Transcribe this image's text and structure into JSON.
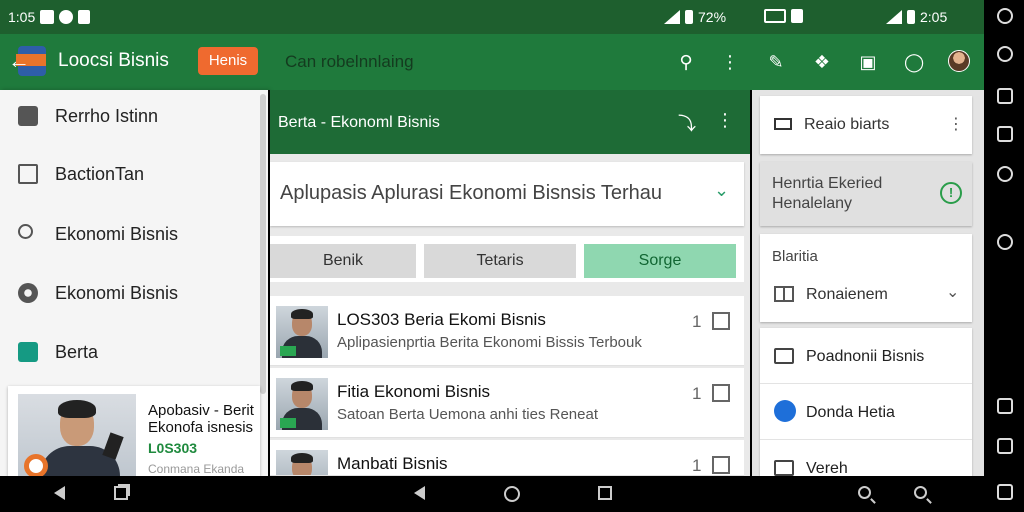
{
  "status_bar": {
    "time_left": "1:05",
    "battery_mid": "72%",
    "time_right": "2:05"
  },
  "app_bar": {
    "title": "Loocsi Bisnis",
    "chip": "Henis",
    "subtitle": "Can robelnnlaing"
  },
  "drawer": {
    "items": [
      {
        "label": "Rerrho Istinn",
        "icon": "briefcase-icon"
      },
      {
        "label": "BactionTan",
        "icon": "document-icon"
      },
      {
        "label": "Ekonomi Bisnis",
        "icon": "search-icon"
      },
      {
        "label": "Ekonomi Bisnis",
        "icon": "gear-icon"
      },
      {
        "label": "Berta",
        "icon": "shopping-bag-icon"
      }
    ],
    "promo": {
      "title": "Apobasiv - Berit Ekonofa isnesis",
      "code": "L0S303",
      "caption": "Conmana Ekanda"
    }
  },
  "center": {
    "header_title": "Berta - Ekonoml Bisnis",
    "search_text": "Aplupasis Aplurasi Ekonomi Bisnsis Terhau",
    "tabs": [
      {
        "label": "Benik",
        "active": false
      },
      {
        "label": "Tetaris",
        "active": false
      },
      {
        "label": "Sorge",
        "active": true
      }
    ],
    "news": [
      {
        "title": "LOS303 Beria Ekomi Bisnis",
        "sub": "Aplipasienprtia Berita Ekonomi Bissis Terbouk",
        "count": "1"
      },
      {
        "title": "Fitia Ekonomi Bisnis",
        "sub": "Satoan Berta Uemona anhi ties Reneat",
        "count": "1"
      },
      {
        "title": "Manbati Bisnis",
        "sub": "",
        "count": "1"
      }
    ]
  },
  "right": {
    "card1_label": "Reaio biarts",
    "card2_label": "Henrtia Ekeried Henalelany",
    "card3_title": "Blaritia",
    "card3_value": "Ronaienem",
    "list": [
      {
        "label": "Poadnonii Bisnis",
        "icon": "monitor-icon"
      },
      {
        "label": "Donda Hetia",
        "icon": "profile-icon"
      },
      {
        "label": "Vereh",
        "icon": "bookmark-icon"
      }
    ]
  },
  "colors": {
    "appbar": "#1f7a3c",
    "statusbar": "#1e5f2e",
    "accent_orange": "#ef6a2f",
    "tab_active": "#8fd7b0"
  }
}
